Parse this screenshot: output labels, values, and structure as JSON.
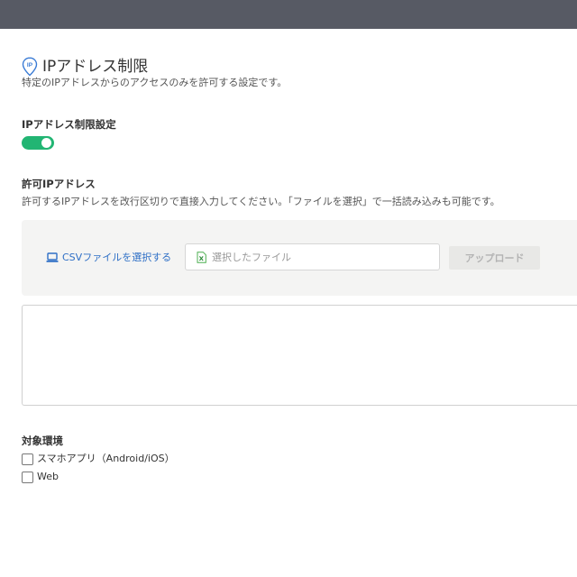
{
  "header": {
    "bar_color": "#575a64"
  },
  "page": {
    "title": "IPアドレス制限",
    "title_icon": "ip-location-pin-icon",
    "subtitle": "特定のIPアドレスからのアクセスのみを許可する設定です。"
  },
  "restriction_setting": {
    "label": "IPアドレス制限設定",
    "enabled": true,
    "toggle_color": "#22b573"
  },
  "allowed_ips": {
    "label": "許可IPアドレス",
    "description": "許可するIPアドレスを改行区切りで直接入力してください。「ファイルを選択」で一括読み込みも可能です。",
    "csv_select_label": "CSVファイルを選択する",
    "csv_select_icon": "laptop-icon",
    "file_field_placeholder": "選択したファイル",
    "file_field_icon": "excel-file-icon",
    "upload_label": "アップロード",
    "textarea_value": ""
  },
  "target_env": {
    "label": "対象環境",
    "options": [
      {
        "label": "スマホアプリ（Android/iOS）",
        "checked": false
      },
      {
        "label": "Web",
        "checked": false
      }
    ]
  },
  "colors": {
    "link": "#2e6fc6",
    "panel_bg": "#f4f4f3"
  }
}
